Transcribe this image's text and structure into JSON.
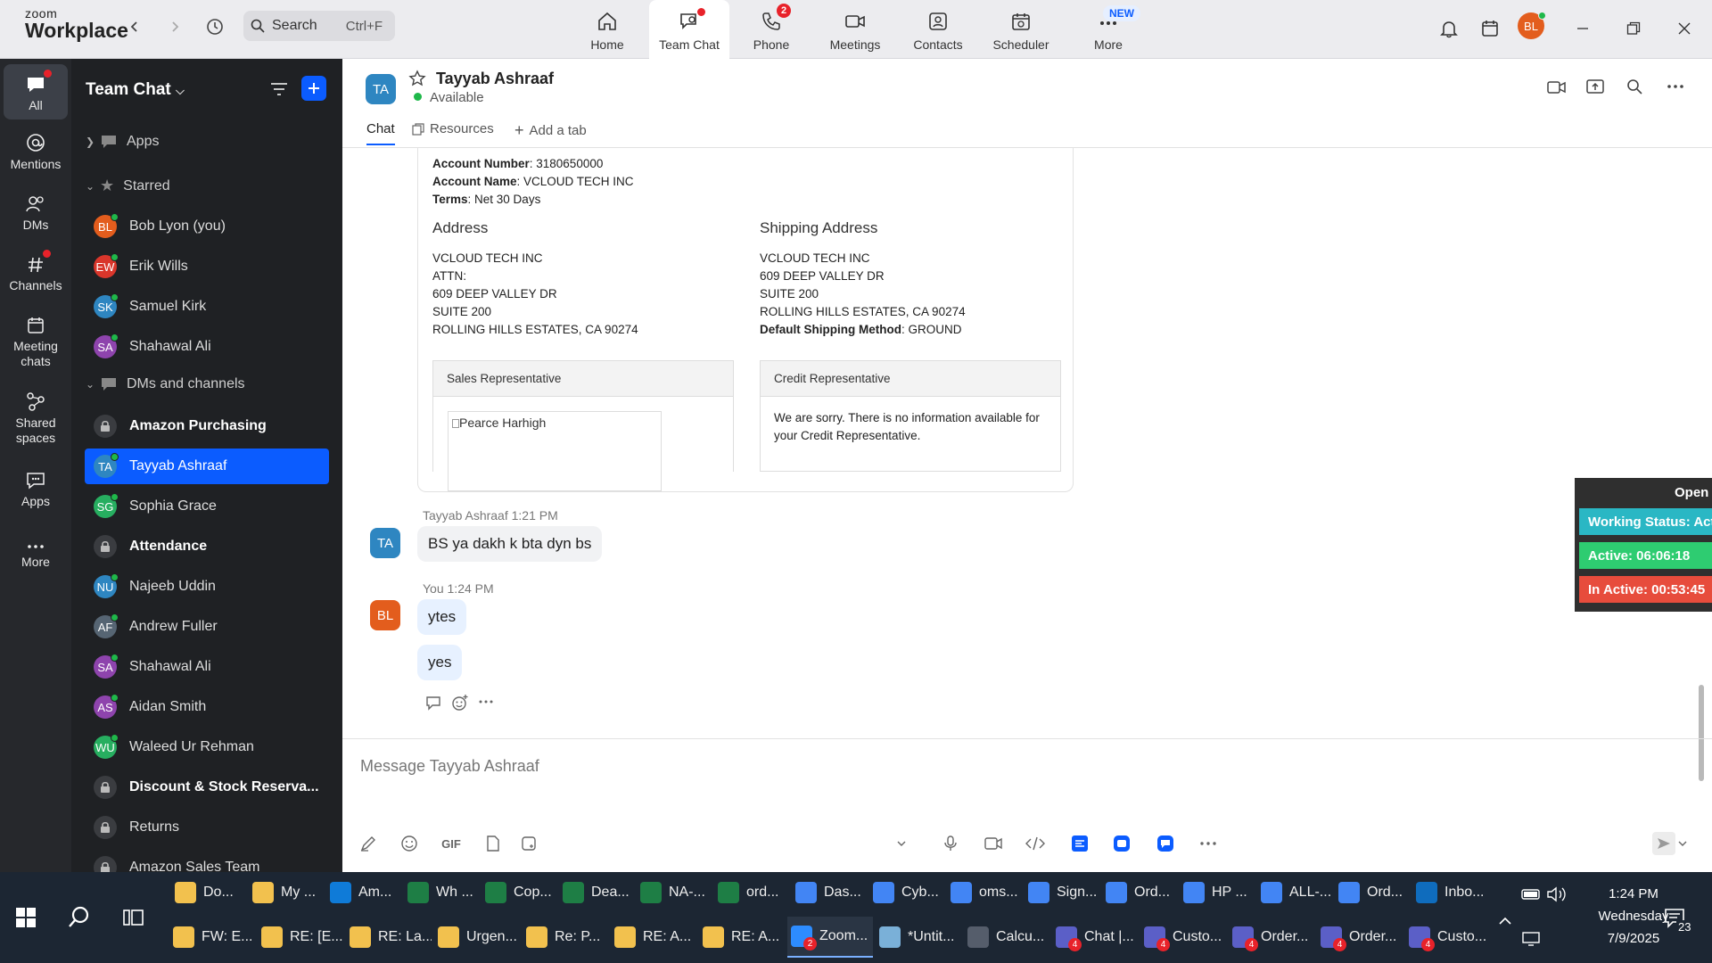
{
  "app": {
    "brand_top": "zoom",
    "brand_bottom": "Workplace"
  },
  "search": {
    "placeholder": "Search",
    "shortcut": "Ctrl+F"
  },
  "nav": [
    {
      "label": "Home"
    },
    {
      "label": "Team Chat"
    },
    {
      "label": "Phone",
      "badge": "2"
    },
    {
      "label": "Meetings"
    },
    {
      "label": "Contacts"
    },
    {
      "label": "Scheduler"
    },
    {
      "label": "More",
      "badge": "NEW"
    }
  ],
  "user": {
    "initials": "BL"
  },
  "rail": [
    {
      "label": "All"
    },
    {
      "label": "Mentions"
    },
    {
      "label": "DMs"
    },
    {
      "label": "Channels"
    },
    {
      "label": "Meeting chats"
    },
    {
      "label": "Shared spaces"
    },
    {
      "label": "Apps"
    },
    {
      "label": "More"
    }
  ],
  "sidebar": {
    "title": "Team Chat",
    "apps_label": "Apps",
    "starred_label": "Starred",
    "starred": [
      {
        "initials": "BL",
        "name": "Bob Lyon (you)",
        "color": "#e35d1d"
      },
      {
        "initials": "EW",
        "name": "Erik Wills",
        "color": "#d9362b"
      },
      {
        "initials": "SK",
        "name": "Samuel Kirk",
        "color": "#2e86c1"
      },
      {
        "initials": "SA",
        "name": "Shahawal Ali",
        "color": "#8e44ad"
      }
    ],
    "dms_label": "DMs and channels",
    "items": [
      {
        "type": "channel",
        "name": "Amazon Purchasing"
      },
      {
        "initials": "TA",
        "name": "Tayyab Ashraaf",
        "color": "#2e86c1"
      },
      {
        "initials": "SG",
        "name": "Sophia Grace",
        "color": "#27ae60"
      },
      {
        "type": "channel",
        "name": "Attendance"
      },
      {
        "initials": "NU",
        "name": "Najeeb Uddin",
        "color": "#2e86c1"
      },
      {
        "initials": "AF",
        "name": "Andrew Fuller",
        "color": "#566573"
      },
      {
        "initials": "SA",
        "name": "Shahawal Ali",
        "color": "#8e44ad"
      },
      {
        "initials": "AS",
        "name": "Aidan Smith",
        "color": "#8e44ad"
      },
      {
        "initials": "WU",
        "name": "Waleed Ur Rehman",
        "color": "#27ae60"
      },
      {
        "type": "channel",
        "name": "Discount & Stock Reserva..."
      },
      {
        "type": "channel",
        "name": "Returns"
      },
      {
        "type": "channel",
        "name": "Amazon Sales Team"
      }
    ]
  },
  "chat": {
    "contact_initials": "TA",
    "contact_name": "Tayyab Ashraaf",
    "status": "Available",
    "tabs": [
      "Chat",
      "Resources",
      "Add a tab"
    ],
    "card": {
      "account_number_label": "Account Number",
      "account_number": ": 3180650000",
      "account_name_label": "Account Name",
      "account_name": ": VCLOUD TECH INC",
      "terms_label": "Terms",
      "terms": ": Net 30 Days",
      "address_title": "Address",
      "address": [
        "VCLOUD TECH INC",
        "ATTN:",
        "609 DEEP VALLEY DR",
        "SUITE 200",
        "ROLLING HILLS ESTATES, CA 90274"
      ],
      "shipping_title": "Shipping Address",
      "shipping": [
        "VCLOUD TECH INC",
        "609 DEEP VALLEY DR",
        "SUITE 200",
        "ROLLING HILLS ESTATES, CA 90274"
      ],
      "shipping_method_label": "Default Shipping Method",
      "shipping_method": ": GROUND",
      "sales_rep_title": "Sales Representative",
      "sales_rep_img_alt": "Pearce Harhigh",
      "credit_rep_title": "Credit Representative",
      "credit_rep_text": "We are sorry. There is no information available for your Credit Representative."
    },
    "messages": [
      {
        "sender": "Tayyab Ashraaf",
        "time": "1:21 PM",
        "initials": "TA",
        "text": [
          "BS ya dakh k bta dyn bs"
        ]
      },
      {
        "sender": "You",
        "time": "1:24 PM",
        "initials": "BL",
        "text": [
          "ytes",
          "yes"
        ]
      }
    ],
    "composer_placeholder": "Message Tayyab Ashraaf",
    "gif_label": "GIF"
  },
  "tracker": {
    "open_label": "Open",
    "working_status": "Working Status: Active",
    "active": "Active: 06:06:18",
    "inactive": "In Active: 00:53:45"
  },
  "taskbar": {
    "row1": [
      "Do...",
      "My ...",
      "Am...",
      "Wh ...",
      "Cop...",
      "Dea...",
      "NA-...",
      "ord...",
      "Das...",
      "Cyb...",
      "oms...",
      "Sign...",
      "Ord...",
      "HP ...",
      "ALL-...",
      "Ord...",
      "Inbo..."
    ],
    "row2": [
      "FW: E...",
      "RE: [E...",
      "RE: La...",
      "Urgen...",
      "Re: P...",
      "RE: A...",
      "RE: A...",
      "Zoom...",
      "*Untit...",
      "Calcu...",
      "Chat |...",
      "Custo...",
      "Order...",
      "Order...",
      "Custo..."
    ],
    "zoom_badge": "2",
    "teams_badge": "4",
    "time": "1:24 PM",
    "day": "Wednesday",
    "date": "7/9/2025",
    "notif_count": "23"
  },
  "colors": {
    "accent": "#0b5cff",
    "rail": "#26282c",
    "sidebar": "#1f2124",
    "working": "#2ab7c4",
    "active": "#2ecc71",
    "inactive": "#e74c3c"
  }
}
